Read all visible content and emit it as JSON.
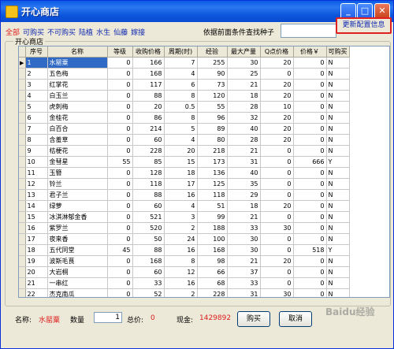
{
  "window": {
    "title": "开心商店"
  },
  "filters": [
    {
      "label": "全部",
      "color": "#e02020"
    },
    {
      "label": "可购买",
      "color": "#1028b0"
    },
    {
      "label": "不可购买",
      "color": "#1028b0"
    },
    {
      "label": "陆植",
      "color": "#1028b0"
    },
    {
      "label": "水生",
      "color": "#1028b0"
    },
    {
      "label": "仙藤",
      "color": "#1028b0"
    },
    {
      "label": "嫁接",
      "color": "#1028b0"
    }
  ],
  "search": {
    "label": "依据前面条件查找种子",
    "value": ""
  },
  "refresh_label": "更新配置信息",
  "group_title": "开心商店",
  "columns": [
    "序号",
    "名称",
    "等级",
    "收购价格",
    "周期(时)",
    "经验",
    "最大产量",
    "Q点价格",
    "价格￥",
    "可购买"
  ],
  "rows": [
    [
      "1",
      "水罂粟",
      "0",
      "166",
      "7",
      "255",
      "30",
      "20",
      "0",
      "N"
    ],
    [
      "2",
      "五色梅",
      "0",
      "168",
      "4",
      "90",
      "25",
      "0",
      "0",
      "N"
    ],
    [
      "3",
      "红掌花",
      "0",
      "117",
      "6",
      "73",
      "21",
      "20",
      "0",
      "N"
    ],
    [
      "4",
      "白玉兰",
      "0",
      "88",
      "8",
      "120",
      "18",
      "20",
      "0",
      "N"
    ],
    [
      "5",
      "虎刺梅",
      "0",
      "20",
      "0.5",
      "55",
      "28",
      "10",
      "0",
      "N"
    ],
    [
      "6",
      "金桂花",
      "0",
      "86",
      "8",
      "96",
      "32",
      "20",
      "0",
      "N"
    ],
    [
      "7",
      "白百合",
      "0",
      "214",
      "5",
      "89",
      "40",
      "20",
      "0",
      "N"
    ],
    [
      "8",
      "含羞草",
      "0",
      "60",
      "4",
      "80",
      "28",
      "20",
      "0",
      "N"
    ],
    [
      "9",
      "桔梗花",
      "0",
      "228",
      "20",
      "218",
      "21",
      "0",
      "0",
      "N"
    ],
    [
      "10",
      "金彗星",
      "55",
      "85",
      "15",
      "173",
      "31",
      "0",
      "666",
      "Y"
    ],
    [
      "11",
      "玉簪",
      "0",
      "128",
      "18",
      "136",
      "40",
      "0",
      "0",
      "N"
    ],
    [
      "12",
      "铃兰",
      "0",
      "118",
      "17",
      "125",
      "35",
      "0",
      "0",
      "N"
    ],
    [
      "13",
      "君子兰",
      "0",
      "88",
      "16",
      "118",
      "29",
      "0",
      "0",
      "N"
    ],
    [
      "14",
      "绿萝",
      "0",
      "60",
      "4",
      "51",
      "18",
      "20",
      "0",
      "N"
    ],
    [
      "15",
      "冰淇淋郁金香",
      "0",
      "521",
      "3",
      "99",
      "21",
      "0",
      "0",
      "N"
    ],
    [
      "16",
      "紫罗兰",
      "0",
      "520",
      "2",
      "188",
      "33",
      "30",
      "0",
      "N"
    ],
    [
      "17",
      "夜来香",
      "0",
      "50",
      "24",
      "100",
      "30",
      "0",
      "0",
      "N"
    ],
    [
      "18",
      "五代同堂",
      "45",
      "88",
      "16",
      "168",
      "30",
      "0",
      "518",
      "Y"
    ],
    [
      "19",
      "波斯毛茛",
      "0",
      "168",
      "8",
      "98",
      "21",
      "20",
      "0",
      "N"
    ],
    [
      "20",
      "大岩桐",
      "0",
      "60",
      "12",
      "66",
      "37",
      "0",
      "0",
      "N"
    ],
    [
      "21",
      "一串红",
      "0",
      "33",
      "16",
      "68",
      "33",
      "0",
      "0",
      "N"
    ],
    [
      "22",
      "杰克南瓜",
      "0",
      "52",
      "2",
      "228",
      "31",
      "30",
      "0",
      "N"
    ]
  ],
  "bottom": {
    "name_label": "名称:",
    "name_value": "水罂粟",
    "qty_label": "数量",
    "qty_value": "1",
    "total_label": "总价:",
    "total_value": "0",
    "cash_label": "现金:",
    "cash_value": "1429892",
    "buy_label": "购买",
    "cancel_label": "取消"
  },
  "watermark": "Baidu经验",
  "colors": {
    "accent_red": "#e02020",
    "link_blue": "#1028b0",
    "selection": "#316ac5"
  }
}
